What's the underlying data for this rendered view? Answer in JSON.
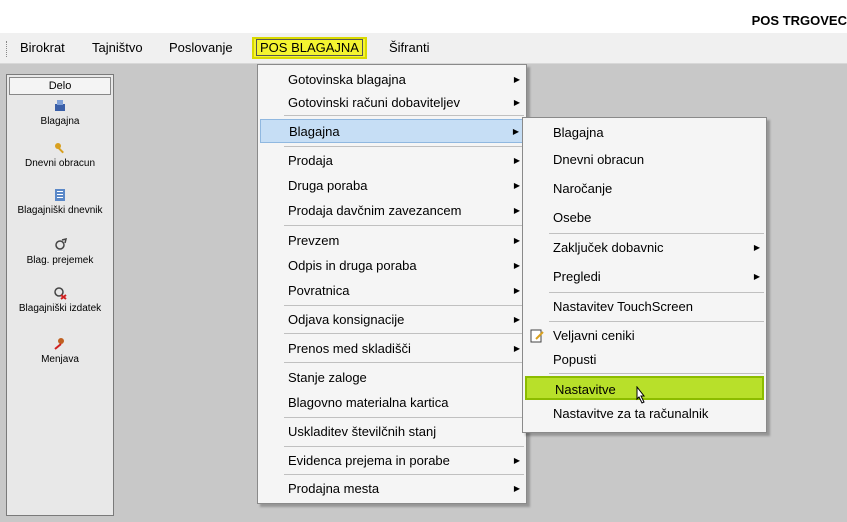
{
  "app_title": "POS TRGOVEC",
  "menubar": {
    "items": [
      {
        "label": "Birokrat"
      },
      {
        "label": "Tajništvo"
      },
      {
        "label": "Poslovanje"
      },
      {
        "label": "POS BLAGAJNA"
      },
      {
        "label": "Šifranti"
      }
    ]
  },
  "left_panel": {
    "header": "Delo",
    "items": [
      {
        "label": "Blagajna",
        "icon": "cash-register-icon"
      },
      {
        "label": "Dnevni obracun",
        "icon": "key-icon"
      },
      {
        "label": "Blagajniški dnevnik",
        "icon": "journal-icon"
      },
      {
        "label": "Blag. prejemek",
        "icon": "receipt-in-icon"
      },
      {
        "label": "Blagajniški izdatek",
        "icon": "receipt-out-icon"
      },
      {
        "label": "Menjava",
        "icon": "exchange-icon"
      }
    ]
  },
  "menu1": {
    "items": [
      {
        "label": "Gotovinska blagajna",
        "submenu": true
      },
      {
        "label": "Gotovinski računi dobaviteljev",
        "submenu": true
      },
      {
        "label": "Blagajna",
        "submenu": true,
        "selected": true
      },
      {
        "label": "Prodaja",
        "submenu": true
      },
      {
        "label": "Druga poraba",
        "submenu": true
      },
      {
        "label": "Prodaja davčnim zavezancem",
        "submenu": true
      },
      {
        "label": "Prevzem",
        "submenu": true
      },
      {
        "label": "Odpis in druga poraba",
        "submenu": true
      },
      {
        "label": "Povratnica",
        "submenu": true
      },
      {
        "label": "Odjava konsignacije",
        "submenu": true
      },
      {
        "label": "Prenos med skladišči",
        "submenu": true
      },
      {
        "label": "Stanje zaloge",
        "submenu": false
      },
      {
        "label": "Blagovno materialna kartica",
        "submenu": false
      },
      {
        "label": "Uskladitev številčnih stanj",
        "submenu": false
      },
      {
        "label": "Evidenca prejema in porabe",
        "submenu": true
      },
      {
        "label": "Prodajna mesta",
        "submenu": true
      }
    ]
  },
  "menu2": {
    "items": [
      {
        "label": "Blagajna",
        "submenu": false
      },
      {
        "label": "Dnevni obracun",
        "submenu": false
      },
      {
        "label": "Naročanje",
        "submenu": false
      },
      {
        "label": "Osebe",
        "submenu": false
      },
      {
        "label": "Zaključek dobavnic",
        "submenu": true
      },
      {
        "label": "Pregledi",
        "submenu": true
      },
      {
        "label": "Nastavitev TouchScreen",
        "submenu": false
      },
      {
        "label": "Veljavni ceniki",
        "submenu": false,
        "icon": "edit-document-icon"
      },
      {
        "label": "Popusti",
        "submenu": false
      },
      {
        "label": "Nastavitve",
        "submenu": false,
        "highlighted": true
      },
      {
        "label": "Nastavitve za ta računalnik",
        "submenu": false
      }
    ]
  },
  "colors": {
    "active_menu": "#f4f430",
    "selected_item": "#c6def5",
    "highlighted_item": "#b8e02a",
    "background": "#c8c8c8"
  }
}
